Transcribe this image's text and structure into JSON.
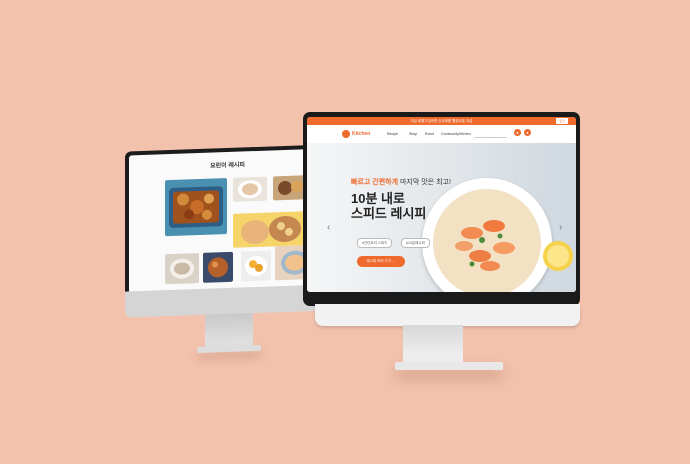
{
  "back_site": {
    "title": "요린이 레시피",
    "subtitle": "",
    "card_labels": [
      "",
      "",
      "",
      "",
      "",
      "",
      ""
    ],
    "colors": {
      "accent": "#f5d46a",
      "bg": "#fafafa"
    }
  },
  "front_site": {
    "promo_text": "지금 회원가입하면 신규회원 웰컴쿠폰 지급",
    "promo_close": "닫기",
    "brand": "Kitchen",
    "nav": [
      "Recipe",
      "Shop",
      "Event",
      "Community",
      "Kitchen"
    ],
    "search_placeholder": "",
    "hero": {
      "line1_prefix": "빠르고 간편하게",
      "line1_suffix": " 마지막 맛은 최고!",
      "line2": "10분 내로",
      "line3": "스피드 레시피",
      "tags": [
        "#간단요리 스피드",
        "#10분레시피"
      ],
      "cta": "레시피 보러 가기 →"
    },
    "colors": {
      "accent": "#ee6a2d"
    }
  }
}
